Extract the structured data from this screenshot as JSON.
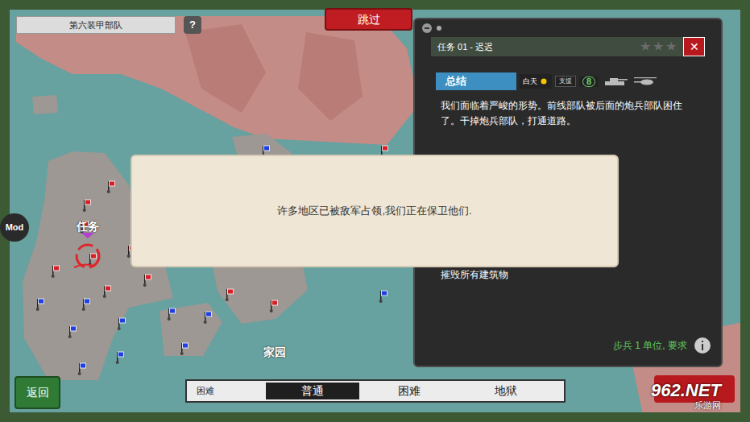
{
  "unit_name": "第六装甲部队",
  "help_button": "?",
  "skip_button": "跳过",
  "mod_button": "Mod",
  "map": {
    "mission_label": "任务",
    "home_label": "家园",
    "pins": [
      {
        "color": "#d81f26"
      },
      {
        "color": "#d81f26"
      },
      {
        "color": "#d81f26"
      },
      {
        "color": "#d81f26"
      },
      {
        "color": "#d81f26"
      },
      {
        "color": "#d81f26"
      },
      {
        "color": "#d81f26"
      },
      {
        "color": "#d81f26"
      },
      {
        "color": "#d81f26"
      },
      {
        "color": "#d81f26"
      },
      {
        "color": "#d81f26"
      },
      {
        "color": "#1f3fe0"
      },
      {
        "color": "#1f3fe0"
      },
      {
        "color": "#1f3fe0"
      },
      {
        "color": "#1f3fe0"
      },
      {
        "color": "#1f3fe0"
      },
      {
        "color": "#1f3fe0"
      },
      {
        "color": "#1f3fe0"
      },
      {
        "color": "#1f3fe0"
      },
      {
        "color": "#1f3fe0"
      },
      {
        "color": "#1f3fe0"
      },
      {
        "color": "#1f3fe0"
      }
    ]
  },
  "mission_panel": {
    "title": "任务 01 - 迟迟",
    "stars": 0,
    "max_stars": 3,
    "close": "✕",
    "tab": "总结",
    "conditions": [
      {
        "kind": "time",
        "label": "白天"
      },
      {
        "kind": "chip",
        "label": "支援"
      },
      {
        "kind": "badge",
        "label": "8"
      },
      {
        "kind": "tank",
        "label": ""
      },
      {
        "kind": "helicopter",
        "label": ""
      }
    ],
    "description": "我们面临着严峻的形势。前线部队被后面的炮兵部队困住了。干掉炮兵部队，打通道路。",
    "objective": "摧毁所有建筑物",
    "requirement": "步兵 1 单位, 要求"
  },
  "dialog": {
    "message": "许多地区已被敌军占领,我们正在保卫他们."
  },
  "back_button": "返回",
  "difficulty": {
    "label": "困难",
    "options": [
      {
        "label": "普通",
        "selected": true
      },
      {
        "label": "困难",
        "selected": false
      },
      {
        "label": "地狱",
        "selected": false
      }
    ]
  },
  "watermark": {
    "brand": "962.NET",
    "site": "乐游网"
  }
}
